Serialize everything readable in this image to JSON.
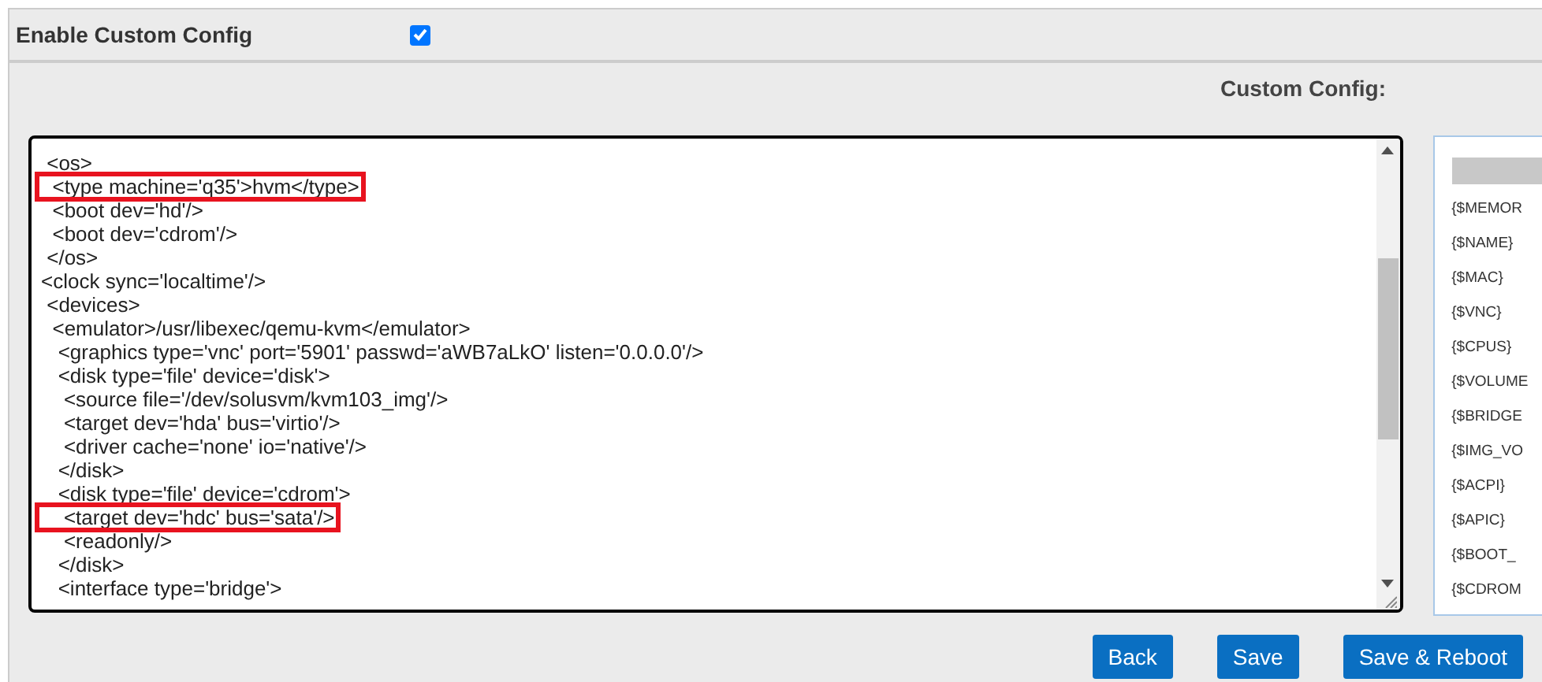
{
  "enable_row": {
    "label": "Enable Custom Config",
    "checked": true
  },
  "config_label": "Custom Config:",
  "code_lines": [
    {
      "text": " <os>",
      "highlighted": false
    },
    {
      "text": "  <type machine='q35'>hvm</type>",
      "highlighted": true
    },
    {
      "text": "  <boot dev='hd'/>",
      "highlighted": false
    },
    {
      "text": "  <boot dev='cdrom'/>",
      "highlighted": false
    },
    {
      "text": " </os>",
      "highlighted": false
    },
    {
      "text": "<clock sync='localtime'/>",
      "highlighted": false
    },
    {
      "text": " <devices>",
      "highlighted": false
    },
    {
      "text": "  <emulator>/usr/libexec/qemu-kvm</emulator>",
      "highlighted": false
    },
    {
      "text": "   <graphics type='vnc' port='5901' passwd='aWB7aLkO' listen='0.0.0.0'/>",
      "highlighted": false
    },
    {
      "text": "   <disk type='file' device='disk'>",
      "highlighted": false
    },
    {
      "text": "    <source file='/dev/solusvm/kvm103_img'/>",
      "highlighted": false
    },
    {
      "text": "    <target dev='hda' bus='virtio'/>",
      "highlighted": false
    },
    {
      "text": "    <driver cache='none' io='native'/>",
      "highlighted": false
    },
    {
      "text": "   </disk>",
      "highlighted": false
    },
    {
      "text": "   <disk type='file' device='cdrom'>",
      "highlighted": false
    },
    {
      "text": "    <target dev='hdc' bus='sata'/>",
      "highlighted": true
    },
    {
      "text": "    <readonly/>",
      "highlighted": false
    },
    {
      "text": "   </disk>",
      "highlighted": false
    },
    {
      "text": "   <interface type='bridge'>",
      "highlighted": false
    }
  ],
  "variables": [
    "{$MEMOR",
    "{$NAME}",
    "{$MAC}",
    "{$VNC}",
    "{$CPUS}",
    "{$VOLUME",
    "{$BRIDGE",
    "{$IMG_VO",
    "{$ACPI}",
    "{$APIC}",
    "{$BOOT_",
    "{$CDROM"
  ],
  "buttons": [
    "Back",
    "Save",
    "Save & Reboot"
  ]
}
